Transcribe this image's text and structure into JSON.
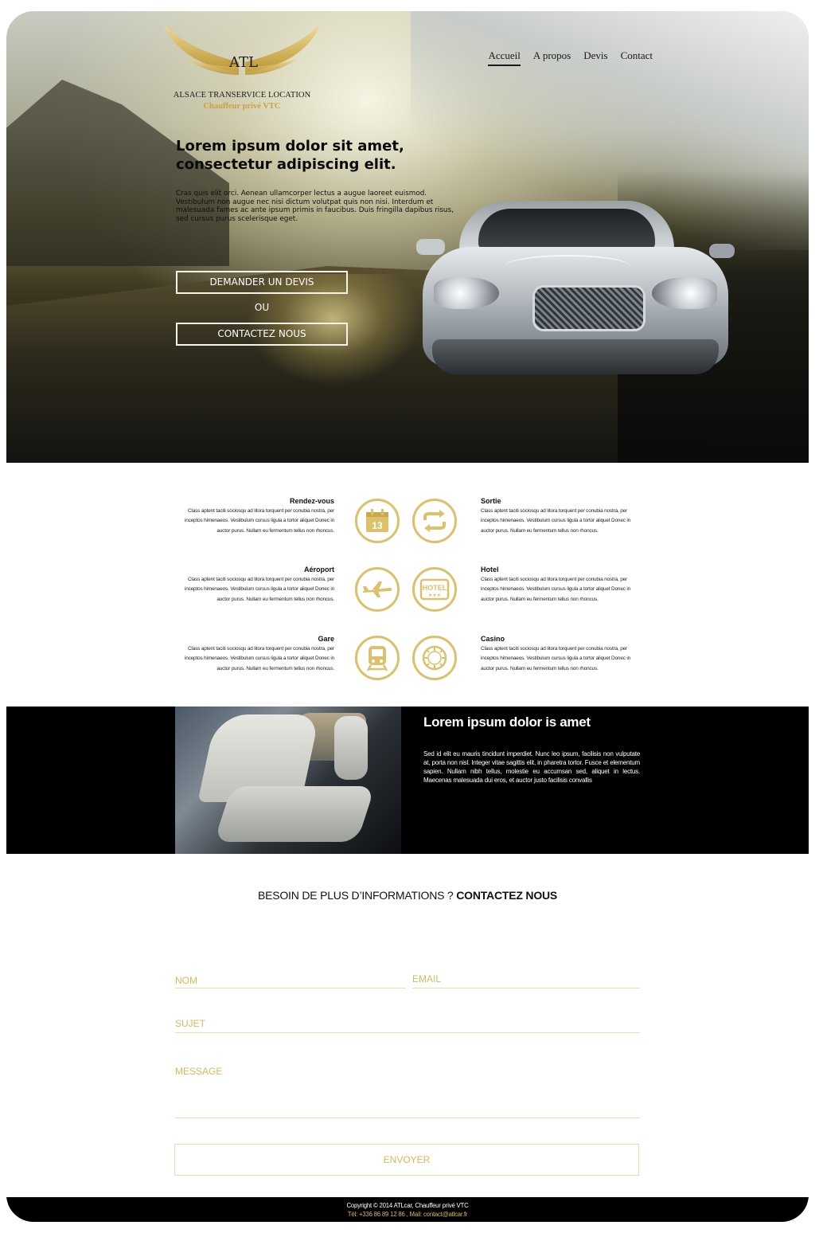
{
  "logo": {
    "monogram": "ATL",
    "brand": "ALSACE TRANSERVICE LOCATION",
    "tagline": "Chauffeur privé VTC"
  },
  "nav": {
    "items": [
      "Accueil",
      "A propos",
      "Devis",
      "Contact"
    ],
    "active": "Accueil"
  },
  "hero": {
    "title": "Lorem ipsum dolor sit amet, consectetur adipiscing elit.",
    "text": "Cras quis elit orci. Aenean ullamcorper lectus a augue laoreet euismod. Vestibulum non augue nec nisi dictum volutpat quis non nisi. Interdum et malesuada fames ac ante ipsum primis in faucibus. Duis fringilla dapibus risus, sed cursus purus scelerisque eget.",
    "btn_devis": "DEMANDER UN DEVIS",
    "or": "OU",
    "btn_contact": "CONTACTEZ NOUS"
  },
  "services": [
    {
      "title": "Rendez-vous",
      "text": "Class aptent taciti sociosqu ad litora torquent per conubia nostra, per inceptos himenaeos. Vestibulum cursus ligula a tortor aliquet Donec in auctor purus. Nullam eu fermentum tellus non rhoncus.",
      "icon": "calendar-icon",
      "icon_label": "13"
    },
    {
      "title": "Sortie",
      "text": "Class aptent taciti sociosqu ad litora torquent per conubia nostra, per inceptos himenaeos. Vestibulum cursus ligula a tortor aliquet Donec in auctor purus. Nullam eu fermentum tellus non rhoncus.",
      "icon": "repeat-arrows-icon"
    },
    {
      "title": "Aéroport",
      "text": "Class aptent taciti sociosqu ad litora torquent per conubia nostra, per inceptos himenaeos. Vestibulum cursus ligula a tortor aliquet Donec in auctor purus. Nullam eu fermentum tellus non rhoncus.",
      "icon": "airplane-icon"
    },
    {
      "title": "Hotel",
      "text": "Class aptent taciti sociosqu ad litora torquent per conubia nostra, per inceptos himenaeos. Vestibulum cursus ligula a tortor aliquet Donec in auctor purus. Nullam eu fermentum tellus non rhoncus.",
      "icon": "hotel-sign-icon",
      "icon_label": "HOTEL"
    },
    {
      "title": "Gare",
      "text": "Class aptent taciti sociosqu ad litora torquent per conubia nostra, per inceptos himenaeos. Vestibulum cursus ligula a tortor aliquet Donec in auctor purus. Nullam eu fermentum tellus non rhoncus.",
      "icon": "train-icon"
    },
    {
      "title": "Casino",
      "text": "Class aptent taciti sociosqu ad litora torquent per conubia nostra, per inceptos himenaeos. Vestibulum cursus ligula a tortor aliquet Donec in auctor purus. Nullam eu fermentum tellus non rhoncus.",
      "icon": "casino-chip-icon"
    }
  ],
  "feature": {
    "title": "Lorem ipsum dolor is amet",
    "text": "Sed id elit eu mauris tincidunt imperdiet. Nunc leo ipsum, facilisis non vulputate at, porta non nisl. Integer vitae sagittis elit, in pharetra tortor. Fusce et elementum sapien. Nullam nibh tellus, molestie eu accumsan sed, aliquet in lectus. Maecenas malesuada dui eros, et auctor justo facilisis convallis"
  },
  "contact": {
    "heading_regular": "BESOIN DE PLUS D’INFORMATIONS ?",
    "heading_bold": "CONTACTEZ NOUS",
    "nom_placeholder": "NOM",
    "email_placeholder": "EMAIL",
    "sujet_placeholder": "SUJET",
    "message_placeholder": "MESSAGE",
    "submit": "ENVOYER"
  },
  "footer": {
    "line1": "Copyright © 2014 ATLcar, Chauffeur privé VTC",
    "line2": "Tél: +336 86 89 12 86 , Mail: contact@atlcar.fr"
  },
  "colors": {
    "accent_gold": "#d9b85c",
    "dark": "#000000"
  }
}
